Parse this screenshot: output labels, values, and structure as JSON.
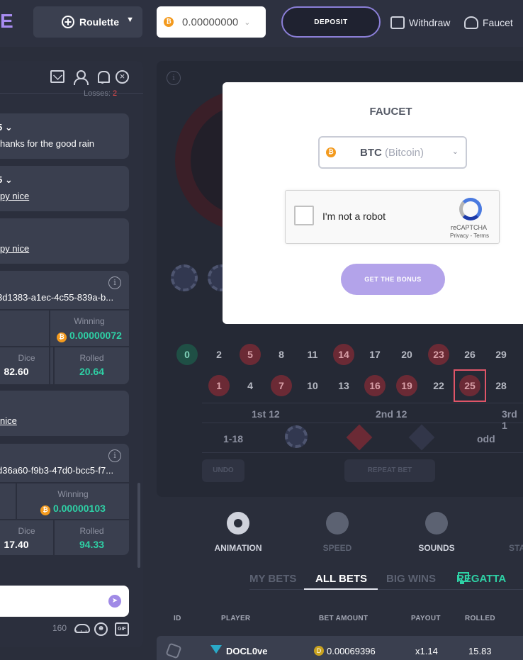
{
  "header": {
    "logo_fragment": "E",
    "game_select_label": "Roulette",
    "balance": "0.00000000",
    "deposit_label": "DEPOSIT",
    "withdraw_label": "Withdraw",
    "faucet_label": "Faucet"
  },
  "chat": {
    "losses_label": "Losses:",
    "losses_value": "2",
    "messages": [
      {
        "meta": "5 ⌄",
        "text": "hanks for the good rain"
      },
      {
        "meta": "5 ⌄",
        "text": "py nice"
      },
      {
        "meta": "",
        "text": "py nice"
      }
    ],
    "bet_cards": [
      {
        "hash": "3d1383-a1ec-4c55-839a-b...",
        "winning_label": "Winning",
        "winning_value": "0.00000072",
        "dice_label": "Dice",
        "dice_value": "82.60",
        "rolled_label": "Rolled",
        "rolled_value": "20.64"
      },
      {
        "hash": "d36a60-f9b3-47d0-bcc5-f7...",
        "winning_label": "Winning",
        "winning_value": "0.00000103",
        "dice_label": "Dice",
        "dice_value": "17.40",
        "rolled_label": "Rolled",
        "rolled_value": "94.33"
      }
    ],
    "nice_text": " nice",
    "char_count": "160"
  },
  "roulette": {
    "row_top": [
      "2",
      "5",
      "8",
      "11",
      "14",
      "17",
      "20",
      "23",
      "26",
      "29"
    ],
    "row_bottom": [
      "1",
      "4",
      "7",
      "10",
      "13",
      "16",
      "19",
      "22",
      "25",
      "28"
    ],
    "zero": "0",
    "selected": "25",
    "dozens": [
      "1st 12",
      "2nd 12",
      "3rd 1"
    ],
    "outside": {
      "low": "1-18",
      "odd": "odd"
    },
    "undo_label": "UNDO",
    "repeat_label": "REPEAT BET"
  },
  "controls": [
    {
      "label": "ANIMATION"
    },
    {
      "label": "SPEED"
    },
    {
      "label": "SOUNDS"
    },
    {
      "label": "STA"
    }
  ],
  "bets": {
    "tabs": [
      "MY BETS",
      "ALL BETS",
      "BIG WINS",
      "REGATTA"
    ],
    "active_tab": "ALL BETS",
    "columns": [
      "ID",
      "PLAYER",
      "BET AMOUNT",
      "PAYOUT",
      "ROLLED"
    ],
    "rows": [
      {
        "player": "DOCL0ve",
        "amount": "0.00069396",
        "payout": "x1.14",
        "rolled": "15.83"
      }
    ]
  },
  "modal": {
    "title": "FAUCET",
    "currency_symbol": "BTC",
    "currency_name": "(Bitcoin)",
    "captcha_label": "I'm not a robot",
    "captcha_brand": "reCAPTCHA",
    "captcha_terms": "Privacy - Terms",
    "bonus_button": "GET THE BONUS"
  },
  "colors": {
    "accent_purple": "#8b7fd8",
    "green_value": "#2ed0a5",
    "btc_orange": "#f39a1e",
    "red_number": "#6b2a35"
  }
}
